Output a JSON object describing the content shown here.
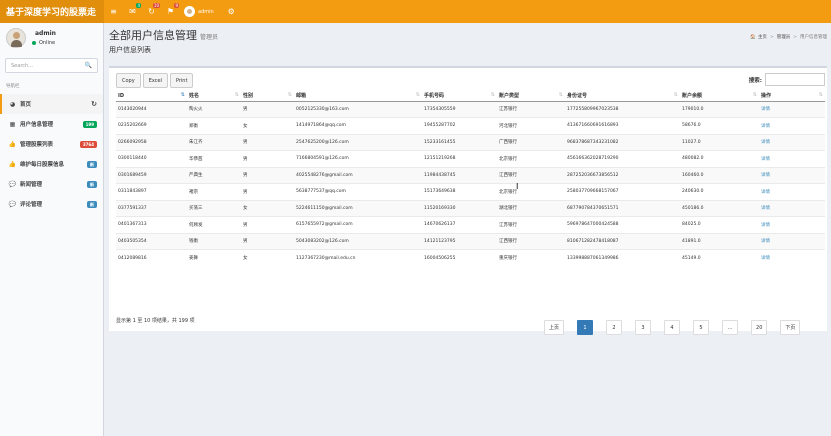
{
  "brand": "基于深度学习的股票走",
  "topnav": {
    "items": [
      {
        "icon": "hamburger-icon",
        "glyph": "≡"
      },
      {
        "icon": "envelope-icon",
        "glyph": "✉",
        "badge": "4",
        "badge_color": "#00a65a"
      },
      {
        "icon": "refresh-icon",
        "glyph": "↻",
        "badge": "10",
        "badge_color": "#dd4b39"
      },
      {
        "icon": "flag-icon",
        "glyph": "⚑",
        "badge": "9",
        "badge_color": "#dd4b39"
      }
    ],
    "user_name": "admin",
    "gears_glyph": "⚙"
  },
  "sidebar": {
    "user_name": "admin",
    "status": "Online",
    "search_placeholder": "Search...",
    "search_icon": "🔍",
    "header": "导航栏",
    "items": [
      {
        "label": "首页",
        "icon": "dashboard-icon",
        "glyph": "◕",
        "active": true,
        "trailing": "↻"
      },
      {
        "label": "用户信息管理",
        "icon": "th-icon",
        "glyph": "▦",
        "badge": "199",
        "badge_color": "#00a65a"
      },
      {
        "label": "管理股票列表",
        "icon": "thumbs-up-icon",
        "glyph": "👍",
        "badge": "3764",
        "badge_color": "#dd4b39"
      },
      {
        "label": "维护每日股票信息",
        "icon": "thumbs-up-icon-2",
        "glyph": "👍",
        "badge": "新",
        "badge_color": "#3c8dbc"
      },
      {
        "label": "新闻管理",
        "icon": "comment-icon",
        "glyph": "💬",
        "badge": "新",
        "badge_color": "#3c8dbc"
      },
      {
        "label": "评论管理",
        "icon": "comment-icon-2",
        "glyph": "💬",
        "badge": "新",
        "badge_color": "#3c8dbc"
      }
    ]
  },
  "page": {
    "title": "全部用户信息管理",
    "subtitle": "管理员",
    "section_title": "用户信息列表",
    "breadcrumb": {
      "home": "主页",
      "mid": "管理员",
      "current": "用户信息管理",
      "home_glyph": "🏠"
    }
  },
  "toolbar": {
    "copy": "Copy",
    "excel": "Excel",
    "print": "Print",
    "search_label": "搜索:"
  },
  "table": {
    "headers": [
      "ID",
      "姓名",
      "性别",
      "邮箱",
      "手机号码",
      "账户类型",
      "身份证号",
      "账户余额",
      "操作"
    ],
    "rows": [
      [
        "0143020944",
        "陶火火",
        "男",
        "0052125330@163.com",
        "17354305559",
        "江苏银行",
        "177255809967023538",
        "179010.0",
        "详情"
      ],
      [
        "0235202669",
        "郑衡",
        "女",
        "1414971864@qq.com",
        "19455287702",
        "河北银行",
        "413671660691616893",
        "58676.0",
        "详情"
      ],
      [
        "0266092958",
        "朱江齐",
        "男",
        "2547625200@126.com",
        "15233161455",
        "广西银行",
        "968378687343231082",
        "11027.0",
        "详情"
      ],
      [
        "0300118440",
        "华恭茜",
        "男",
        "7166804591@126.com",
        "12151219268",
        "北京银行",
        "456166362028719290",
        "480082.0",
        "详情"
      ],
      [
        "0301689459",
        "严典生",
        "男",
        "4025548276@gmail.com",
        "11984438745",
        "江西银行",
        "287252036673856512",
        "160460.0",
        "详情"
      ],
      [
        "0311843897",
        "褚宗",
        "男",
        "5638777537@qq.com",
        "15173649638",
        "北京银行",
        "258037709668157067",
        "240630.0",
        "详情"
      ],
      [
        "0377591337",
        "买荡三",
        "女",
        "5224611150@gmail.com",
        "11520169330",
        "湖北银行",
        "687790784370651571",
        "450186.0",
        "详情"
      ],
      [
        "0401367313",
        "何顾发",
        "男",
        "6157655972@gmail.com",
        "14670626137",
        "江苏银行",
        "596978647000424588",
        "84025.0",
        "详情"
      ],
      [
        "0403505354",
        "钱衡",
        "男",
        "5043083202@126.com",
        "14121123795",
        "江西银行",
        "810671282478418087",
        "41891.0",
        "详情"
      ],
      [
        "0412089816",
        "姜舞",
        "女",
        "1127367230@mail.edu.cn",
        "16004506255",
        "重庆银行",
        "133998887061349986",
        "45149.0",
        "详情"
      ]
    ]
  },
  "table_info": "显示第 1 至 10 项结果，共 199 项",
  "pagination": [
    "上页",
    "1",
    "2",
    "3",
    "4",
    "5",
    "...",
    "20",
    "下页"
  ]
}
